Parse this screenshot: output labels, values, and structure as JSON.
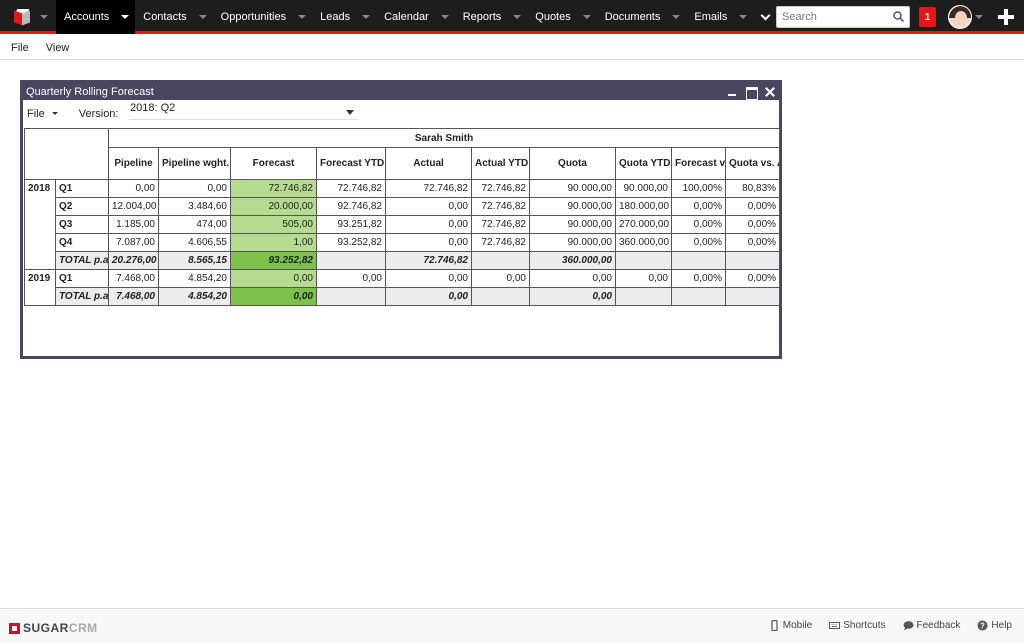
{
  "topbar": {
    "nav": [
      {
        "label": "Accounts",
        "active": true
      },
      {
        "label": "Contacts"
      },
      {
        "label": "Opportunities"
      },
      {
        "label": "Leads"
      },
      {
        "label": "Calendar"
      },
      {
        "label": "Reports"
      },
      {
        "label": "Quotes"
      },
      {
        "label": "Documents"
      },
      {
        "label": "Emails"
      }
    ],
    "search_placeholder": "Search",
    "notification_count": "1"
  },
  "menubar": {
    "file": "File",
    "view": "View"
  },
  "window": {
    "title": "Quarterly Rolling Forecast",
    "toolbar": {
      "file_label": "File",
      "version_label": "Version:",
      "version_value": "2018: Q2"
    },
    "table": {
      "group_header": "Sarah Smith",
      "columns": [
        "Pipeline",
        "Pipeline wght.",
        "Forecast",
        "Forecast YTD",
        "Actual",
        "Actual YTD",
        "Quota",
        "Quota YTD",
        "Forecast vs. Actual",
        "Quota vs. Actual"
      ],
      "years": [
        {
          "year": "2018",
          "rows": [
            {
              "label": "Q1",
              "cells": [
                "0,00",
                "0,00",
                "72.746,82",
                "72.746,82",
                "72.746,82",
                "72.746,82",
                "90.000,00",
                "90.000,00",
                "100,00%",
                "80,83%"
              ]
            },
            {
              "label": "Q2",
              "cells": [
                "12.004,00",
                "3.484,60",
                "20.000,00",
                "92.746,82",
                "0,00",
                "72.746,82",
                "90.000,00",
                "180.000,00",
                "0,00%",
                "0,00%"
              ]
            },
            {
              "label": "Q3",
              "cells": [
                "1.185,00",
                "474,00",
                "505,00",
                "93.251,82",
                "0,00",
                "72.746,82",
                "90.000,00",
                "270.000,00",
                "0,00%",
                "0,00%"
              ]
            },
            {
              "label": "Q4",
              "cells": [
                "7.087,00",
                "4.606,55",
                "1,00",
                "93.252,82",
                "0,00",
                "72.746,82",
                "90.000,00",
                "360.000,00",
                "0,00%",
                "0,00%"
              ]
            },
            {
              "label": "TOTAL p.a.",
              "total": true,
              "cells": [
                "20.276,00",
                "8.565,15",
                "93.252,82",
                "",
                "72.746,82",
                "",
                "360.000,00",
                "",
                "",
                ""
              ]
            }
          ]
        },
        {
          "year": "2019",
          "rows": [
            {
              "label": "Q1",
              "cells": [
                "7.468,00",
                "4.854,20",
                "0,00",
                "0,00",
                "0,00",
                "0,00",
                "0,00",
                "0,00",
                "0,00%",
                "0,00%"
              ]
            },
            {
              "label": "TOTAL p.a.",
              "total": true,
              "cells": [
                "7.468,00",
                "4.854,20",
                "0,00",
                "",
                "0,00",
                "",
                "0,00",
                "",
                "",
                ""
              ]
            }
          ]
        }
      ]
    }
  },
  "footer": {
    "brand_main": "SUGAR",
    "brand_accent": "CRM",
    "links": [
      {
        "label": "Mobile",
        "icon": "mobile-icon"
      },
      {
        "label": "Shortcuts",
        "icon": "keyboard-icon"
      },
      {
        "label": "Feedback",
        "icon": "chat-icon"
      },
      {
        "label": "Help",
        "icon": "help-icon"
      }
    ]
  },
  "colors": {
    "accent": "#e61718",
    "window_frame": "#4a4660",
    "forecast_cell": "#b4db8e",
    "forecast_total": "#7cc24a"
  }
}
